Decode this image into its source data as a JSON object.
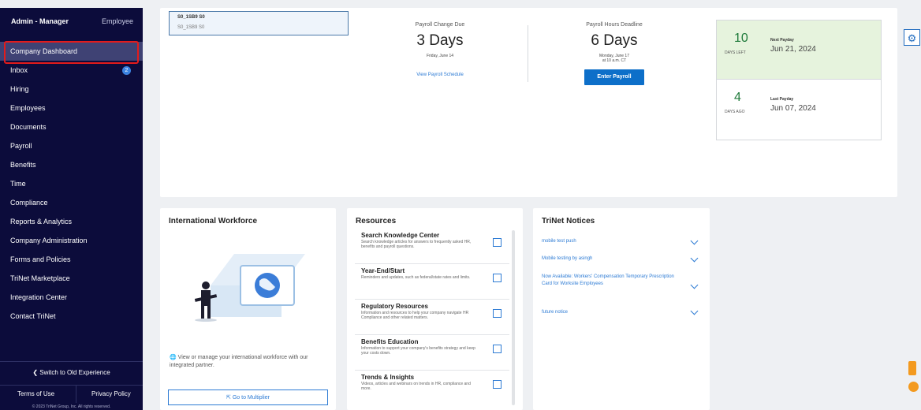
{
  "sidebar": {
    "role_admin": "Admin - Manager",
    "role_employee": "Employee",
    "items": [
      {
        "label": "Company Dashboard"
      },
      {
        "label": "Inbox",
        "badge": "2"
      },
      {
        "label": "Hiring"
      },
      {
        "label": "Employees"
      },
      {
        "label": "Documents"
      },
      {
        "label": "Payroll"
      },
      {
        "label": "Benefits"
      },
      {
        "label": "Time"
      },
      {
        "label": "Compliance"
      },
      {
        "label": "Reports & Analytics"
      },
      {
        "label": "Company Administration"
      },
      {
        "label": "Forms and Policies"
      },
      {
        "label": "TriNet Marketplace"
      },
      {
        "label": "Integration Center"
      },
      {
        "label": "Contact TriNet"
      }
    ],
    "switch_old": "❮  Switch to Old Experience",
    "terms": "Terms of Use",
    "privacy": "Privacy Policy",
    "copyright": "© 2023 TriNet Group, Inc. All rights reserved."
  },
  "entity": {
    "title": "S0_1SB9 S0",
    "sub": "S0_1SB9 S0"
  },
  "payroll_change": {
    "label": "Payroll Change Due",
    "days": "3 Days",
    "date": "Friday, June 14",
    "link": "View Payroll Schedule"
  },
  "payroll_hours": {
    "label": "Payroll Hours Deadline",
    "days": "6 Days",
    "date": "Monday, June 17",
    "time": "at 10 a.m. CT",
    "button": "Enter Payroll"
  },
  "next_payday": {
    "num": "10",
    "sub": "DAYS LEFT",
    "label": "Next Payday",
    "date": "Jun 21, 2024"
  },
  "last_payday": {
    "num": "4",
    "sub": "DAYS AGO",
    "label": "Last Payday",
    "date": "Jun 07, 2024"
  },
  "intl": {
    "title": "International Workforce",
    "text": "View or manage your international workforce with our integrated partner.",
    "button": "Go to Multiplier"
  },
  "resources": {
    "title": "Resources",
    "items": [
      {
        "title": "Search Knowledge Center",
        "desc": "Search knowledge articles for answers to frequently asked HR, benefits and payroll questions."
      },
      {
        "title": "Year-End/Start",
        "desc": "Reminders and updates, such as federal/state rates and limits."
      },
      {
        "title": "Regulatory Resources",
        "desc": "Information and resources to help your company navigate HR Compliance and other related matters."
      },
      {
        "title": "Benefits Education",
        "desc": "Information to support your company's benefits strategy and keep your costs down."
      },
      {
        "title": "Trends & Insights",
        "desc": "Videos, articles and webinars on trends in HR, compliance and more."
      }
    ]
  },
  "notices": {
    "title": "TriNet Notices",
    "items": [
      {
        "text": "mobile test push"
      },
      {
        "text": "Mobile testing by asingh"
      },
      {
        "text": "Now Available: Workers' Compensation Temporary Prescription Card for Worksite Employees"
      },
      {
        "text": "future notice"
      }
    ]
  }
}
